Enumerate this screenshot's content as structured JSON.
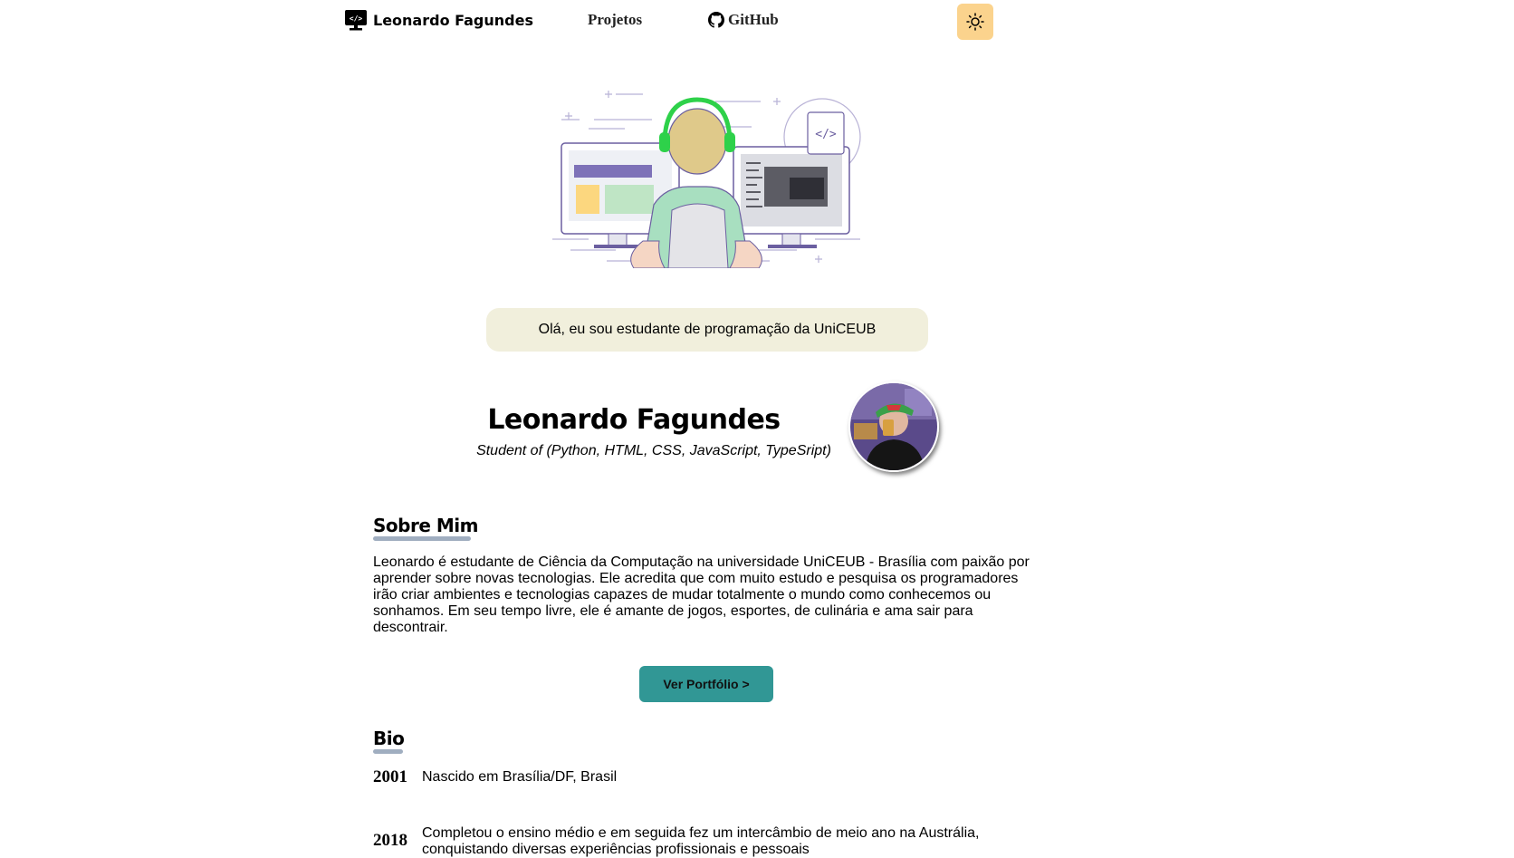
{
  "nav": {
    "brand_name": "Leonardo Fagundes",
    "links": [
      {
        "label": "Projetos"
      },
      {
        "label": "GitHub",
        "icon": "github-icon"
      }
    ],
    "theme_toggle_icon": "sun-icon",
    "theme_toggle_color": "#fbd38d"
  },
  "hero": {
    "illustration": "developer-at-dual-monitors-illustration",
    "greeting": "Olá, eu sou estudante de programação da UniCEUB"
  },
  "profile": {
    "name": "Leonardo Fagundes",
    "role": "Student of (Python, HTML, CSS, JavaScript, TypeSript)"
  },
  "about": {
    "heading": "Sobre Mim",
    "text": "Leonardo é estudante de Ciência da Computação na universidade UniCEUB - Brasília com paixão por aprender sobre novas tecnologias. Ele acredita que com muito estudo e pesquisa os programadores irão criar ambientes e tecnologias capazes de mudar totalmente o mundo como conhecemos ou sonhamos. Em seu tempo livre, ele é amante de jogos, esportes, de culinária e ama sair para descontrair.",
    "button_label": "Ver Portfólio >",
    "button_color": "#319795"
  },
  "bio": {
    "heading": "Bio",
    "entries": [
      {
        "year": "2001",
        "text": "Nascido em Brasília/DF, Brasil"
      },
      {
        "year": "2018",
        "text": "Completou o ensino médio e em seguida fez um intercâmbio de meio ano na Austrália, conquistando diversas experiências profissionais e pessoais"
      }
    ]
  }
}
